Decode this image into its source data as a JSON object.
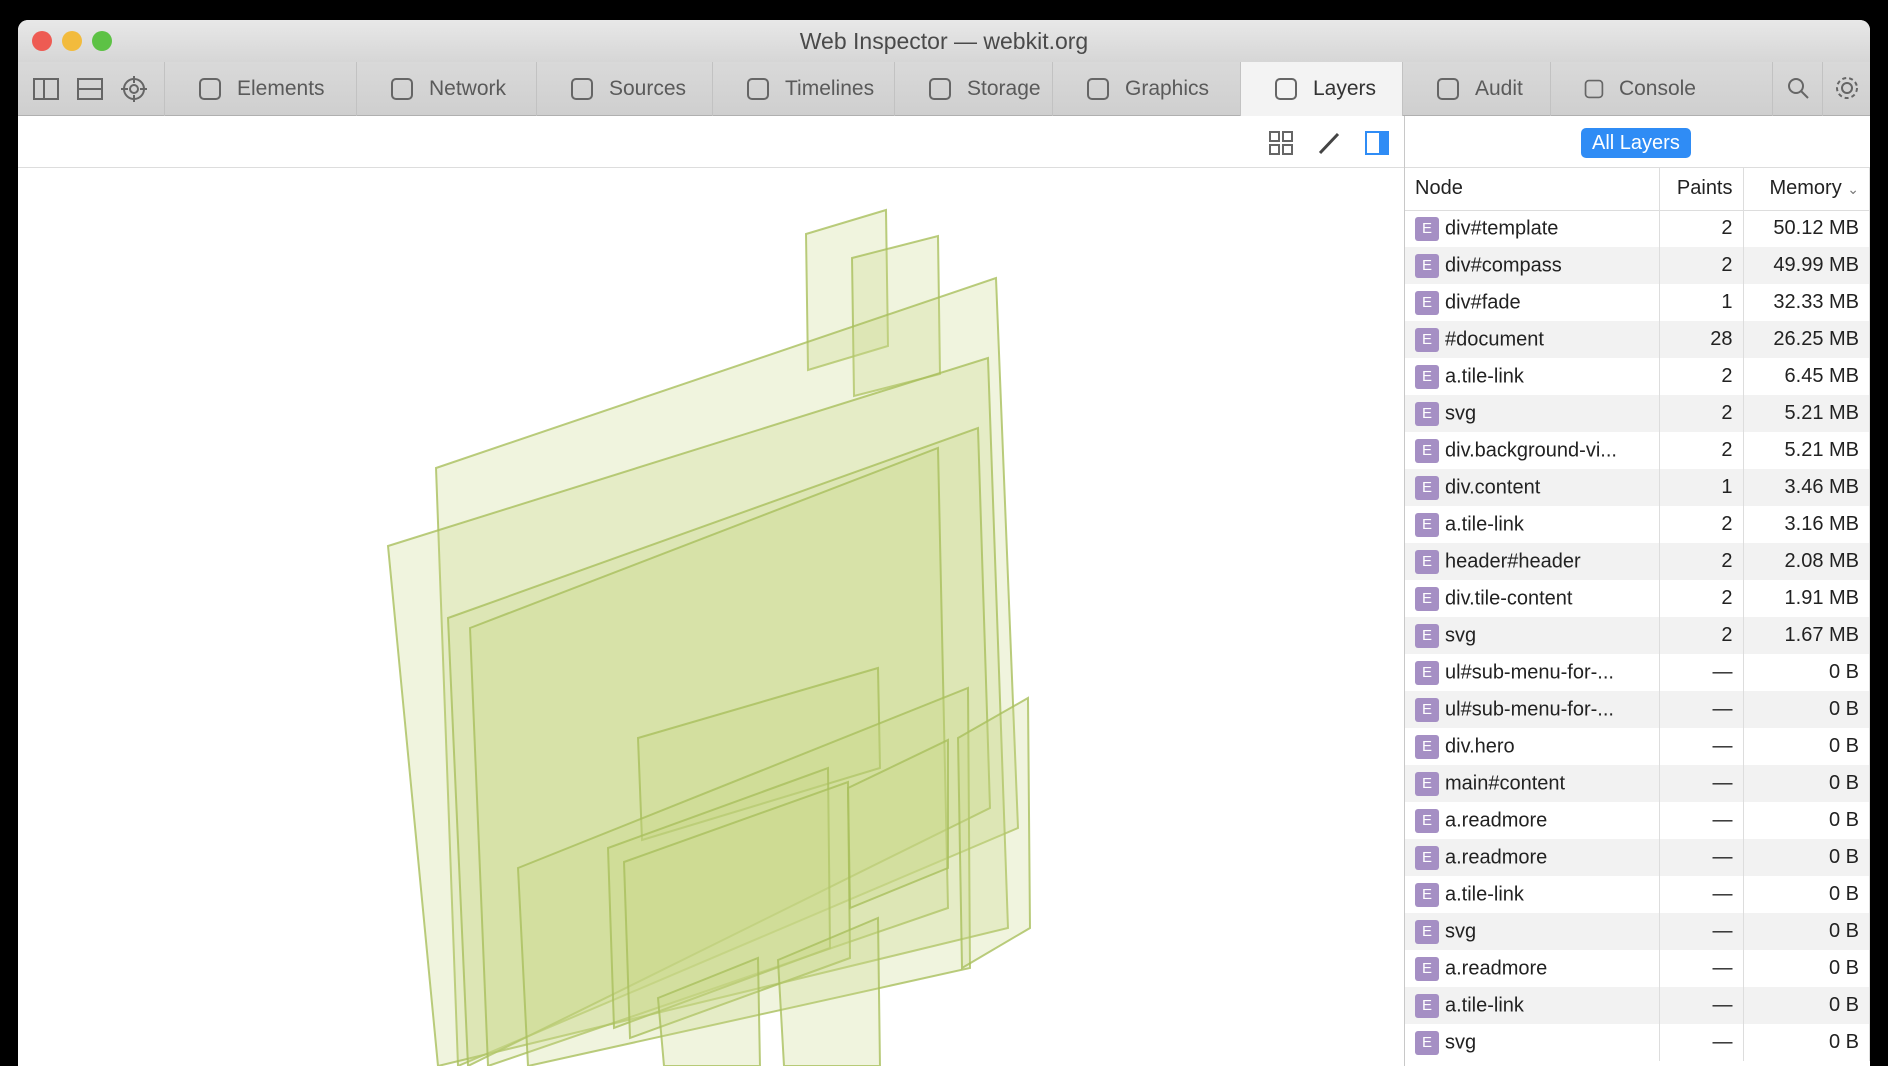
{
  "window": {
    "title": "Web Inspector — webkit.org"
  },
  "tabs": [
    {
      "label": "Elements",
      "icon": "elements-icon"
    },
    {
      "label": "Network",
      "icon": "network-icon"
    },
    {
      "label": "Sources",
      "icon": "sources-icon"
    },
    {
      "label": "Timelines",
      "icon": "timelines-icon"
    },
    {
      "label": "Storage",
      "icon": "storage-icon"
    },
    {
      "label": "Graphics",
      "icon": "graphics-icon"
    },
    {
      "label": "Layers",
      "icon": "layers-icon",
      "active": true
    },
    {
      "label": "Audit",
      "icon": "audit-icon"
    },
    {
      "label": "Console",
      "icon": "console-icon"
    }
  ],
  "sidebar": {
    "scope_button": "All Layers",
    "columns": {
      "node": "Node",
      "paints": "Paints",
      "memory": "Memory"
    },
    "rows": [
      {
        "badge": "E",
        "node": "div#template",
        "paints": "2",
        "memory": "50.12 MB"
      },
      {
        "badge": "E",
        "node": "div#compass",
        "paints": "2",
        "memory": "49.99 MB"
      },
      {
        "badge": "E",
        "node": "div#fade",
        "paints": "1",
        "memory": "32.33 MB"
      },
      {
        "badge": "E",
        "node": "#document",
        "paints": "28",
        "memory": "26.25 MB"
      },
      {
        "badge": "E",
        "node": "a.tile-link",
        "paints": "2",
        "memory": "6.45 MB"
      },
      {
        "badge": "E",
        "node": "svg",
        "paints": "2",
        "memory": "5.21 MB"
      },
      {
        "badge": "E",
        "node": "div.background-vi...",
        "paints": "2",
        "memory": "5.21 MB"
      },
      {
        "badge": "E",
        "node": "div.content",
        "paints": "1",
        "memory": "3.46 MB"
      },
      {
        "badge": "E",
        "node": "a.tile-link",
        "paints": "2",
        "memory": "3.16 MB"
      },
      {
        "badge": "E",
        "node": "header#header",
        "paints": "2",
        "memory": "2.08 MB"
      },
      {
        "badge": "E",
        "node": "div.tile-content",
        "paints": "2",
        "memory": "1.91 MB"
      },
      {
        "badge": "E",
        "node": "svg",
        "paints": "2",
        "memory": "1.67 MB"
      },
      {
        "badge": "E",
        "node": "ul#sub-menu-for-...",
        "paints": "—",
        "memory": "0 B"
      },
      {
        "badge": "E",
        "node": "ul#sub-menu-for-...",
        "paints": "—",
        "memory": "0 B"
      },
      {
        "badge": "E",
        "node": "div.hero",
        "paints": "—",
        "memory": "0 B"
      },
      {
        "badge": "E",
        "node": "main#content",
        "paints": "—",
        "memory": "0 B"
      },
      {
        "badge": "E",
        "node": "a.readmore",
        "paints": "—",
        "memory": "0 B"
      },
      {
        "badge": "E",
        "node": "a.readmore",
        "paints": "—",
        "memory": "0 B"
      },
      {
        "badge": "E",
        "node": "a.tile-link",
        "paints": "—",
        "memory": "0 B"
      },
      {
        "badge": "E",
        "node": "svg",
        "paints": "—",
        "memory": "0 B"
      },
      {
        "badge": "E",
        "node": "a.readmore",
        "paints": "—",
        "memory": "0 B"
      },
      {
        "badge": "E",
        "node": "a.tile-link",
        "paints": "—",
        "memory": "0 B"
      },
      {
        "badge": "E",
        "node": "svg",
        "paints": "—",
        "memory": "0 B"
      }
    ]
  },
  "colors": {
    "accent": "#2f8cf5",
    "layer_fill": "#c8d98a",
    "layer_stroke": "#a9bf5c",
    "element_badge": "#a58fc4"
  }
}
